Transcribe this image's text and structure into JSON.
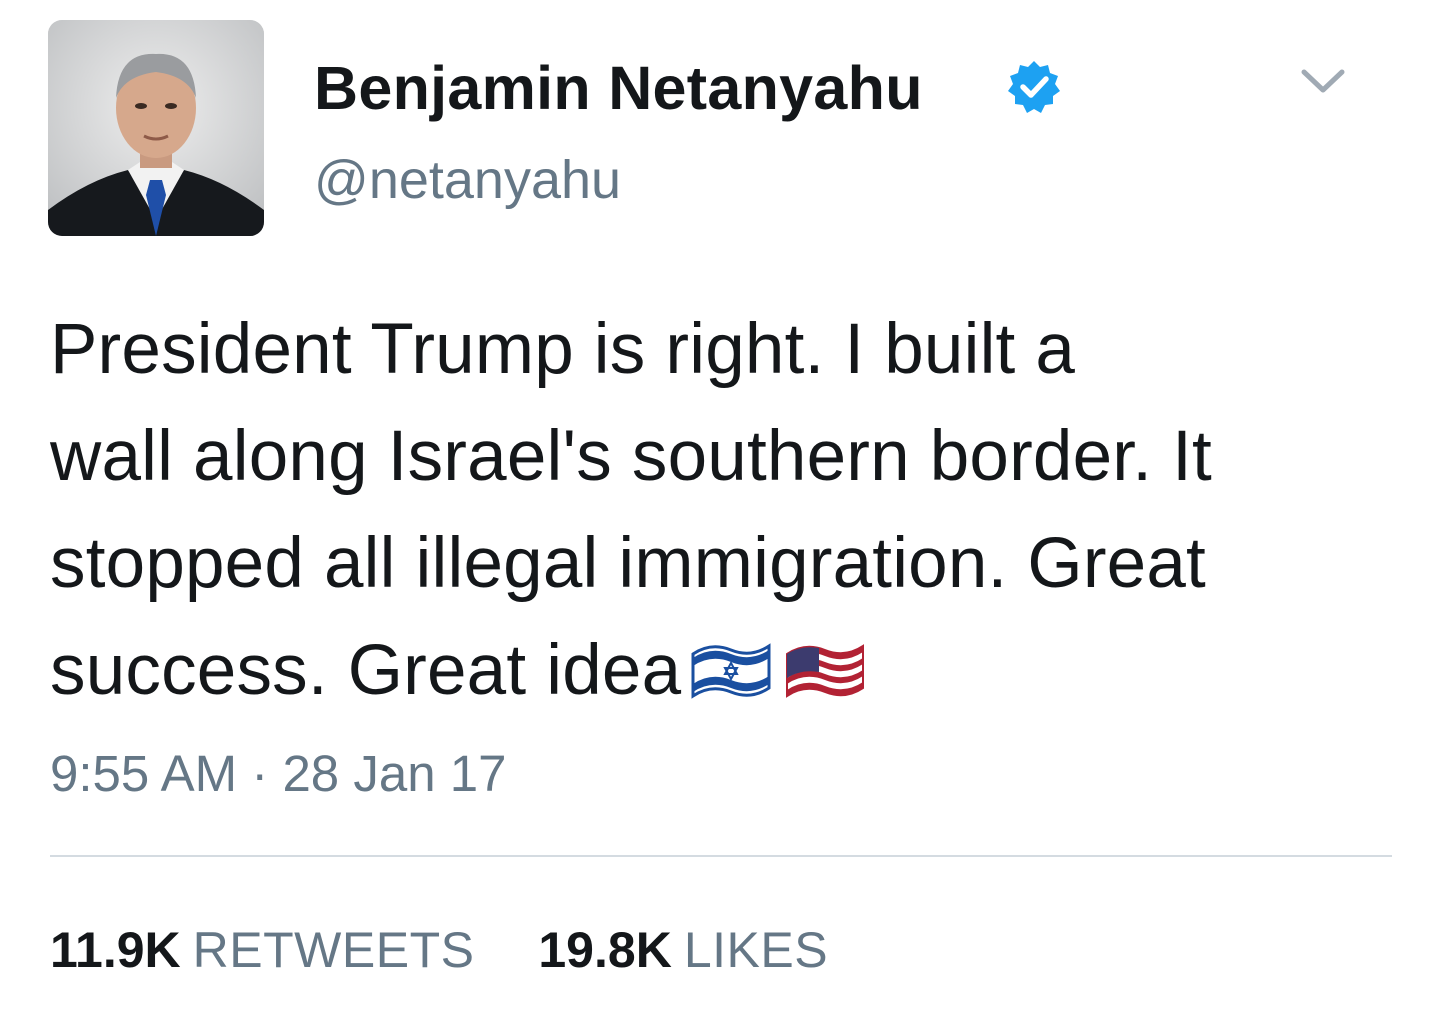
{
  "user": {
    "display_name": "Benjamin Netanyahu",
    "handle": "@netanyahu",
    "verified": true,
    "avatar_icon": "profile-photo"
  },
  "tweet": {
    "lines": [
      "President Trump is right. I built a",
      "wall along Israel's southern border. It",
      "stopped all illegal immigration. Great",
      "success. Great idea"
    ],
    "emoji": [
      "israel-flag-emoji",
      "us-flag-emoji"
    ],
    "timestamp": "9:55 AM · 28 Jan 17"
  },
  "stats": {
    "retweets_count": "11.9K",
    "retweets_label": "RETWEETS",
    "likes_count": "19.8K",
    "likes_label": "LIKES"
  },
  "colors": {
    "text": "#14171a",
    "secondary": "#657786",
    "verified_blue": "#1da1f2",
    "divider": "#d4dbe1"
  }
}
